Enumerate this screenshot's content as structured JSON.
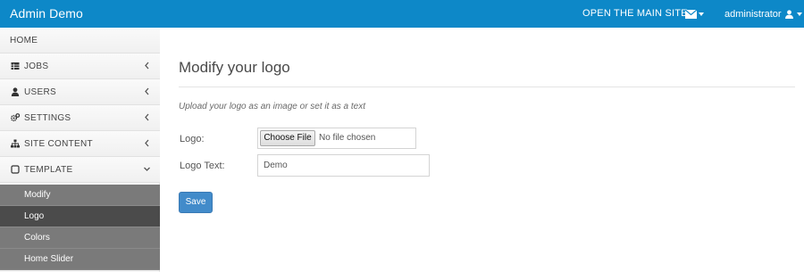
{
  "navbar": {
    "brand": "Admin Demo",
    "open_site_label": "OPEN THE MAIN SITE",
    "mail_icon": "envelope-icon",
    "user_label": "administrator",
    "user_icon": "user-icon",
    "accent_color": "#0d88c8"
  },
  "sidebar": {
    "items": [
      {
        "label": "HOME",
        "icon": ""
      },
      {
        "label": "JOBS",
        "icon": "table-icon"
      },
      {
        "label": "USERS",
        "icon": "user-icon"
      },
      {
        "label": "SETTINGS",
        "icon": "cogs-icon"
      },
      {
        "label": "SITE CONTENT",
        "icon": "sitemap-icon"
      },
      {
        "label": "TEMPLATE",
        "icon": "square-icon",
        "expanded": true
      }
    ],
    "subitems": [
      {
        "label": "Modify"
      },
      {
        "label": "Logo",
        "active": true
      },
      {
        "label": "Colors"
      },
      {
        "label": "Home Slider"
      }
    ]
  },
  "main": {
    "title": "Modify your logo",
    "hint": "Upload your logo as an image or set it as a text",
    "logo_label": "Logo:",
    "file_button": "Choose File",
    "file_status": "No file chosen",
    "logo_text_label": "Logo Text:",
    "logo_text_value": "Demo",
    "save_label": "Save",
    "button_color": "#428bca"
  }
}
